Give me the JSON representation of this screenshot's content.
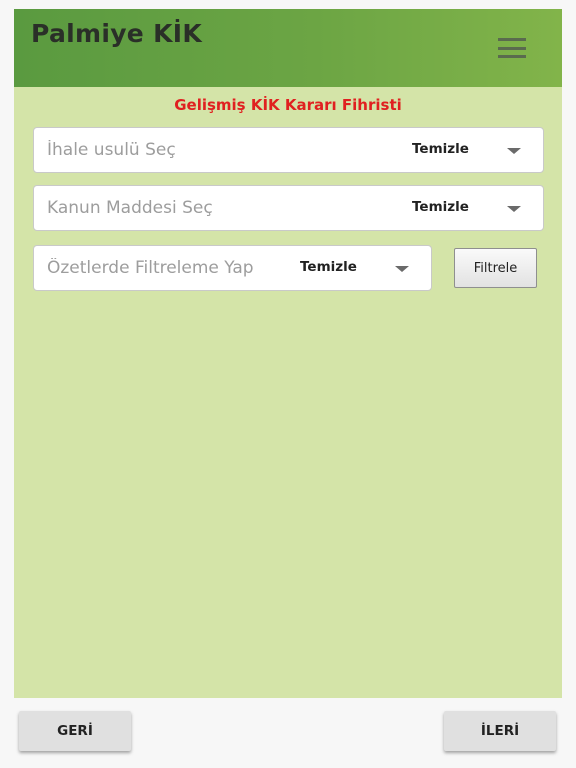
{
  "header": {
    "title": "Palmiye KİK",
    "menu_icon": "hamburger-menu-icon"
  },
  "main": {
    "heading": "Gelişmiş KİK Kararı Fihristi",
    "filters": [
      {
        "placeholder": "İhale usulü Seç",
        "clear_label": "Temizle",
        "dropdown_icon": "caret-down-icon"
      },
      {
        "placeholder": "Kanun Maddesi Seç",
        "clear_label": "Temizle",
        "dropdown_icon": "caret-down-icon"
      },
      {
        "placeholder": "Özetlerde Filtreleme Yap",
        "clear_label": "Temizle",
        "dropdown_icon": "caret-down-icon"
      }
    ],
    "filter_button_label": "Filtrele"
  },
  "footer": {
    "back_label": "GERİ",
    "next_label": "İLERİ"
  },
  "colors": {
    "header_gradient_start": "#5a9a40",
    "header_gradient_end": "#82b44a",
    "content_background": "#d4e4a8",
    "heading_color": "#e02020"
  }
}
